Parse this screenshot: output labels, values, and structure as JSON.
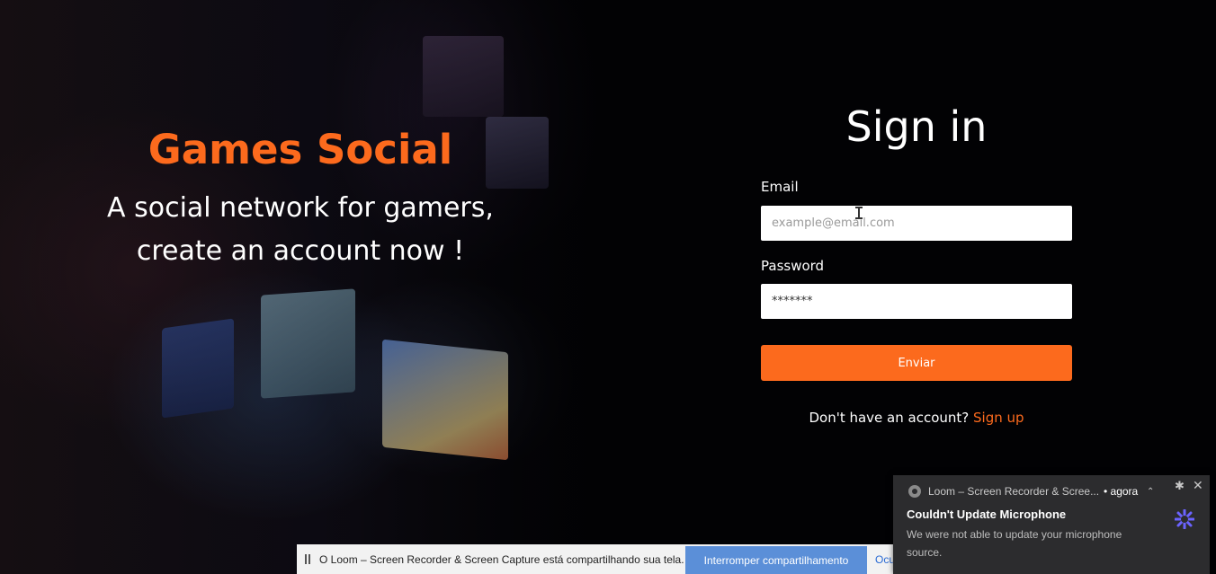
{
  "hero": {
    "brand": "Games Social",
    "tagline_line1": "A social network for gamers,",
    "tagline_line2": "create an account now !"
  },
  "signin": {
    "title": "Sign in",
    "email_label": "Email",
    "email_placeholder": "example@email.com",
    "password_label": "Password",
    "password_value": "*******",
    "submit_label": "Enviar",
    "no_account_text": "Don't have an account? ",
    "signup_link": "Sign up"
  },
  "sharing_bar": {
    "message": "O Loom – Screen Recorder & Screen Capture está compartilhando sua tela.",
    "stop_button": "Interromper compartilhamento",
    "hide_link": "Ocultar"
  },
  "notification": {
    "app_name": "Loom – Screen Recorder & Scree...",
    "time": "• agora",
    "title": "Couldn't Update Microphone",
    "body": "We were not able to update your microphone source."
  },
  "colors": {
    "accent": "#fc6a1d",
    "background": "#020204",
    "notification_bg": "#2c2c2e",
    "stop_button_bg": "#5b8fd8"
  }
}
